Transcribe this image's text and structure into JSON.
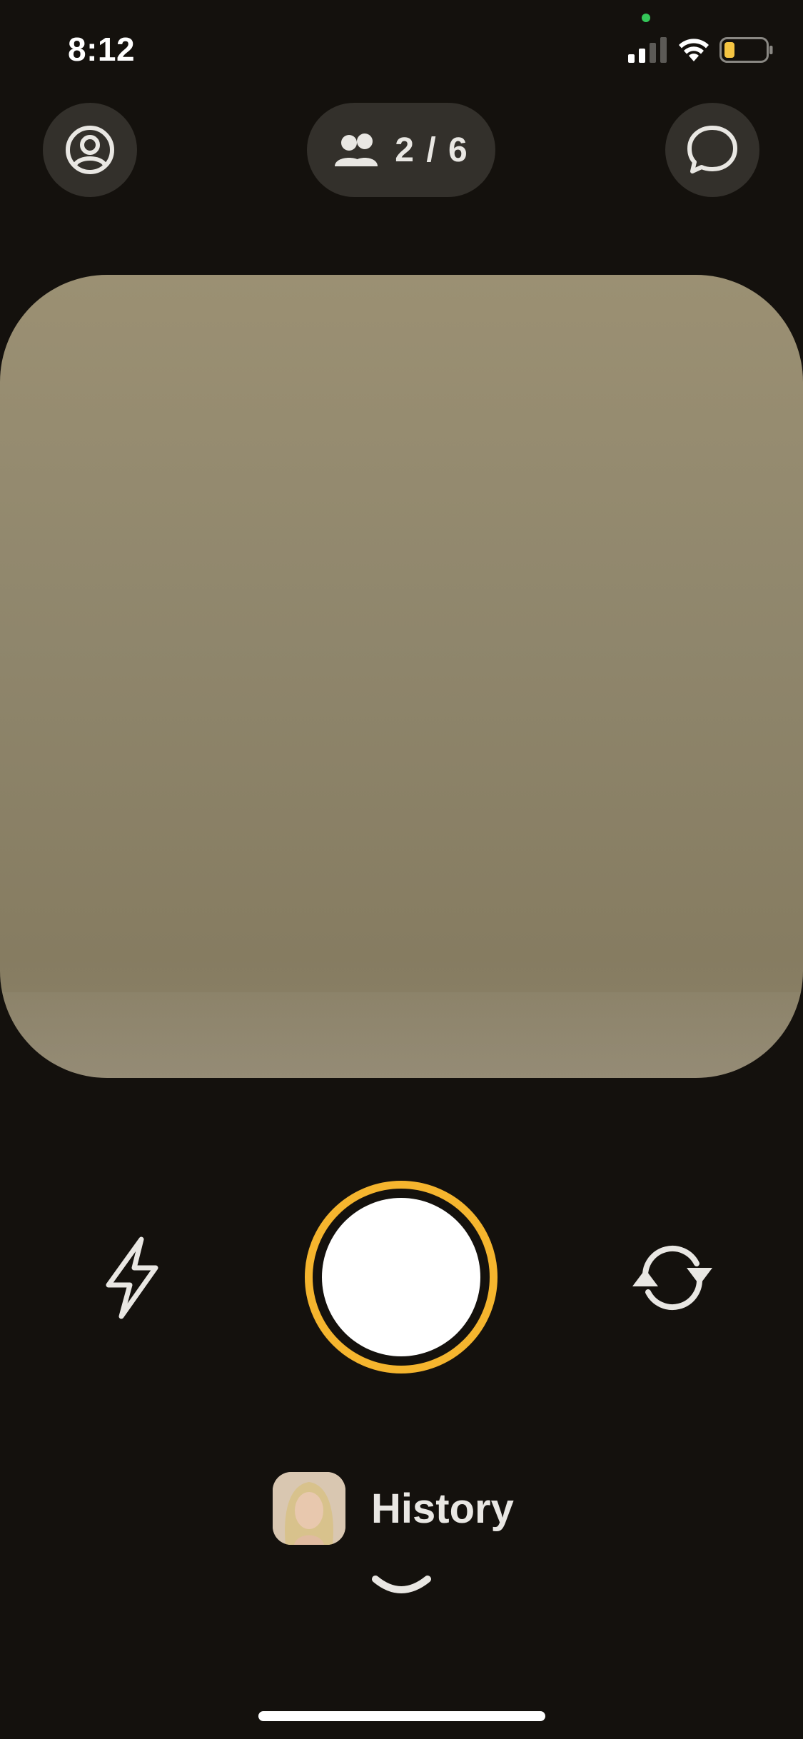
{
  "status_bar": {
    "time": "8:12",
    "battery_color": "#f5c542",
    "privacy_indicator_color": "#34c759"
  },
  "top_bar": {
    "profile_icon": "profile-icon",
    "friends_icon": "friends-icon",
    "friends_count": "2 / 6",
    "chat_icon": "chat-bubble-icon"
  },
  "camera": {
    "flash_icon": "flash-icon",
    "shutter_accent_color": "#f5b52e",
    "flip_icon": "flip-camera-icon"
  },
  "history": {
    "label": "History",
    "thumbnail": "history-thumbnail",
    "expand_icon": "chevron-down-icon"
  }
}
